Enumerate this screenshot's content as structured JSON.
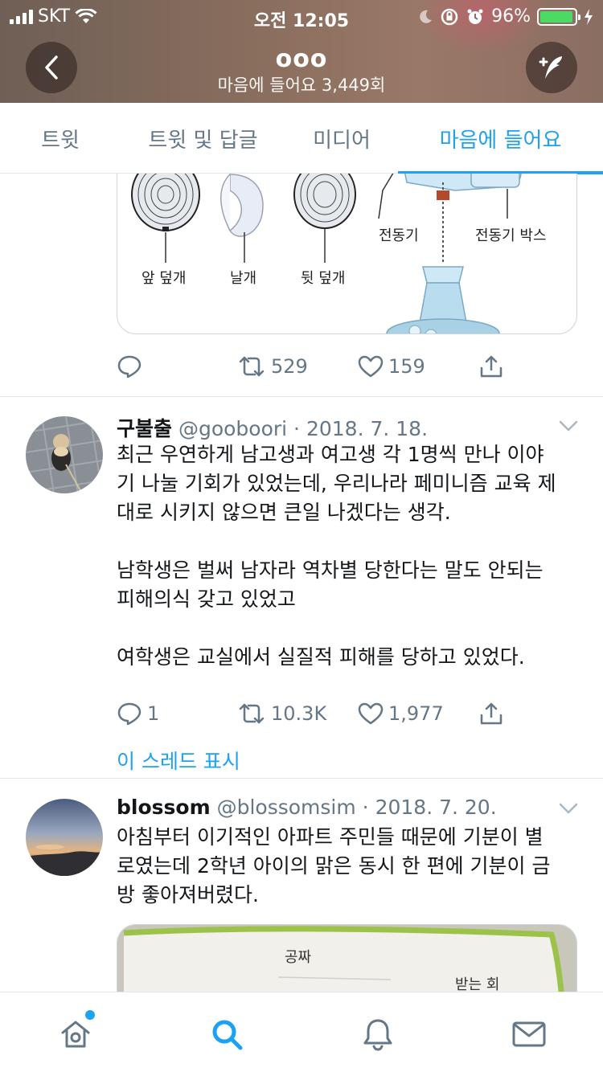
{
  "status_bar": {
    "carrier": "SKT",
    "time": "오전 12:05",
    "battery": "96%",
    "battery_level": 0.96
  },
  "header": {
    "title": "ooo",
    "subtitle": "마음에 들어요 3,449회"
  },
  "tabs": [
    {
      "label": "트윗",
      "active": false
    },
    {
      "label": "트윗 및 답글",
      "active": false
    },
    {
      "label": "미디어",
      "active": false
    },
    {
      "label": "마음에 들어요",
      "active": true
    }
  ],
  "first_tweet": {
    "image_labels": {
      "front_cover": "앞 덮개",
      "blade": "날개",
      "back_cover": "뒷 덮개",
      "motor": "전동기",
      "motor_box": "전동기 박스"
    },
    "actions": {
      "replies": "",
      "retweets": "529",
      "likes": "159"
    }
  },
  "tweets": [
    {
      "name": "구불출",
      "meta": "@gooboori · 2018. 7. 18.",
      "text": "최근 우연하게 남고생과 여고생 각 1명씩 만나 이야\n기 나눌 기회가 있었는데, 우리나라 페미니즘 교육 제\n대로 시키지 않으면 큰일 나겠다는 생각.\n\n남학생은 벌써 남자라 역차별 당한다는 말도 안되는\n피해의식 갖고 있었고\n\n여학생은 교실에서 실질적 피해를 당하고 있었다.",
      "actions": {
        "replies": "1",
        "retweets": "10.3K",
        "likes": "1,977"
      },
      "thread_link": "이 스레드 표시"
    },
    {
      "name": "blossom",
      "meta": "@blossomsim · 2018. 7. 20.",
      "text": "아침부터 이기적인 아파트 주민들 때문에 기분이 별\n로였는데 2학년 아이의 맑은 동시 한 편에 기분이 금\n방 좋아져버렸다.",
      "image_text": {
        "line1": "공짜",
        "line2": "받는 회"
      }
    }
  ],
  "bottom_nav": [
    {
      "icon": "home-icon",
      "active": false,
      "badge": true
    },
    {
      "icon": "search-icon",
      "active": true,
      "badge": false
    },
    {
      "icon": "bell-icon",
      "active": false,
      "badge": false
    },
    {
      "icon": "mail-icon",
      "active": false,
      "badge": false
    }
  ],
  "colors": {
    "accent": "#1da1f2",
    "secondary_text": "#657786",
    "divider": "#e1e8ed"
  }
}
